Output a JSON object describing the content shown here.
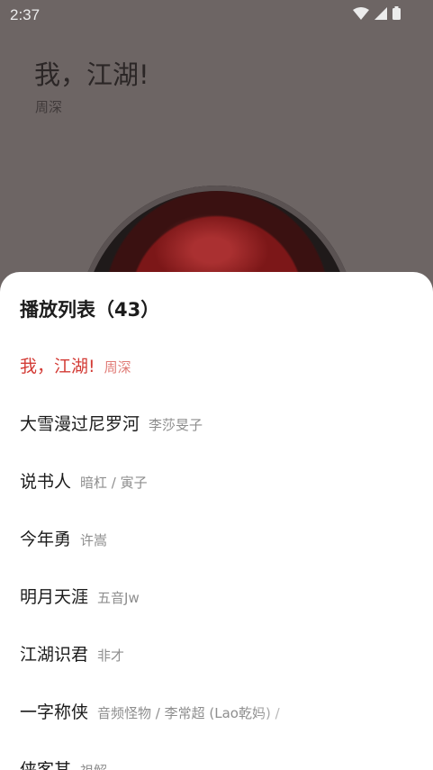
{
  "status_bar": {
    "time": "2:37",
    "icons": [
      "wifi-icon",
      "signal-icon",
      "battery-icon"
    ]
  },
  "now_playing": {
    "title": "我，江湖!",
    "artist": "周深"
  },
  "playlist": {
    "title": "播放列表",
    "count": "（43）",
    "tracks": [
      {
        "name": "我，江湖!",
        "artist": "周深",
        "active": true
      },
      {
        "name": "大雪漫过尼罗河",
        "artist": "李莎旻子"
      },
      {
        "name": "说书人",
        "artist": "暗杠 / 寅子"
      },
      {
        "name": "今年勇",
        "artist": "许嵩"
      },
      {
        "name": "明月天涯",
        "artist": "五音Jw"
      },
      {
        "name": "江湖识君",
        "artist": "非才"
      },
      {
        "name": "一字称侠",
        "artist": "音频怪物 / 李常超 (Lao乾妈) /"
      },
      {
        "name": "侠客其",
        "artist": "祖解"
      }
    ]
  },
  "colors": {
    "accent": "#d33b35",
    "accent_light": "#e07b76",
    "dim_overlay": "#6d6564"
  }
}
